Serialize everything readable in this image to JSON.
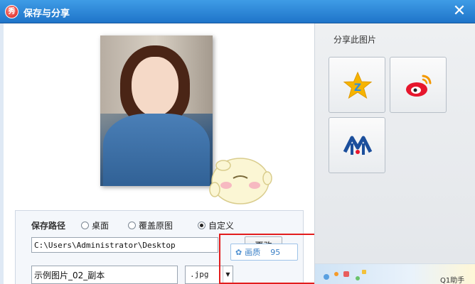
{
  "window": {
    "title": "保存与分享",
    "app_icon_glyph": "秀"
  },
  "save": {
    "path_label": "保存路径",
    "options": [
      {
        "label": "桌面",
        "selected": false
      },
      {
        "label": "覆盖原图",
        "selected": false
      },
      {
        "label": "自定义",
        "selected": true
      }
    ],
    "path_value": "C:\\Users\\Administrator\\Desktop",
    "change_label": "更改",
    "filename_value": "示例图片_02_副本",
    "extension": ".jpg",
    "quality_label": "画质",
    "quality_value": "95"
  },
  "share": {
    "title": "分享此图片",
    "targets": [
      {
        "icon": "qzone-star-icon",
        "color": "#f6b400"
      },
      {
        "icon": "weibo-icon",
        "color": "#e6162d"
      },
      {
        "icon": "renren-icon",
        "color": "#1c4f9c"
      }
    ]
  },
  "ad": {
    "text": "Q1助手"
  },
  "colors": {
    "accent": "#1f74c9",
    "highlight": "#e21d1d"
  }
}
